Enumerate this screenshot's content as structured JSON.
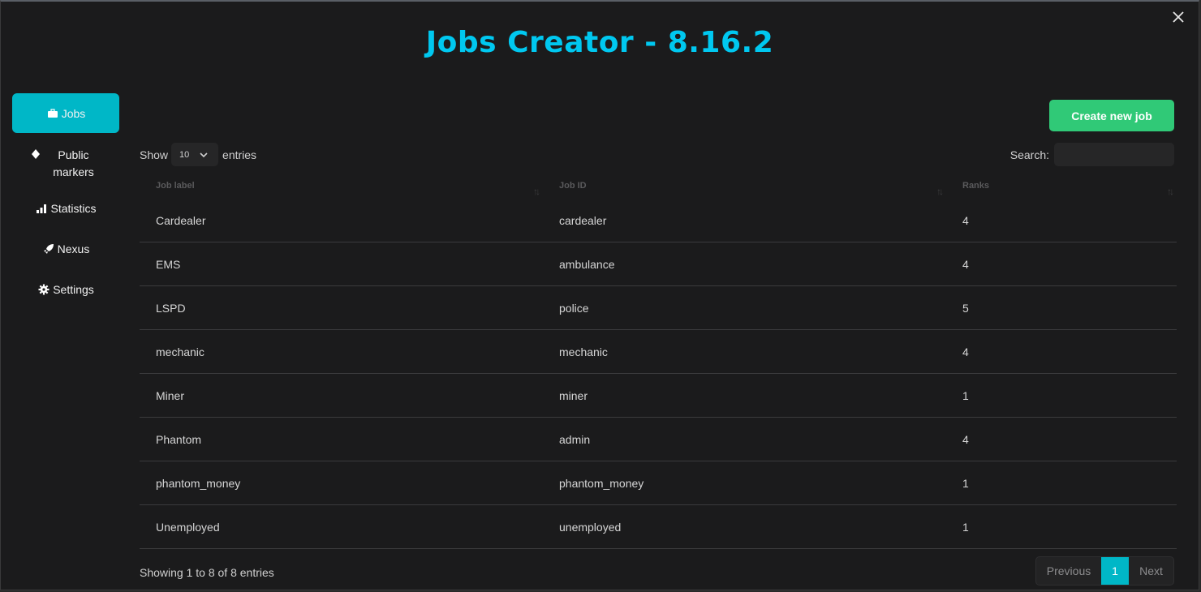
{
  "title": "Jobs Creator - 8.16.2",
  "sidebar": {
    "items": [
      {
        "label": "Jobs",
        "icon": "briefcase-icon"
      },
      {
        "label": "Public markers",
        "icon": "marker-icon"
      },
      {
        "label": "Statistics",
        "icon": "bar-chart-icon"
      },
      {
        "label": "Nexus",
        "icon": "rocket-icon"
      },
      {
        "label": "Settings",
        "icon": "gear-icon"
      }
    ]
  },
  "toolbar": {
    "create_label": "Create new job"
  },
  "controls": {
    "show_label": "Show",
    "entries_value": "10",
    "entries_label": "entries",
    "search_label": "Search:",
    "search_value": ""
  },
  "table": {
    "headers": [
      "Job label",
      "Job ID",
      "Ranks"
    ],
    "rows": [
      [
        "Cardealer",
        "cardealer",
        "4"
      ],
      [
        "EMS",
        "ambulance",
        "4"
      ],
      [
        "LSPD",
        "police",
        "5"
      ],
      [
        "mechanic",
        "mechanic",
        "4"
      ],
      [
        "Miner",
        "miner",
        "1"
      ],
      [
        "Phantom",
        "admin",
        "4"
      ],
      [
        "phantom_money",
        "phantom_money",
        "1"
      ],
      [
        "Unemployed",
        "unemployed",
        "1"
      ]
    ]
  },
  "footer": {
    "info": "Showing 1 to 8 of 8 entries",
    "previous": "Previous",
    "page": "1",
    "next": "Next"
  },
  "colors": {
    "accent": "#00c8f0",
    "active_tab": "#00b7c7",
    "create_button": "#30c977",
    "background": "#1b1b1c"
  }
}
